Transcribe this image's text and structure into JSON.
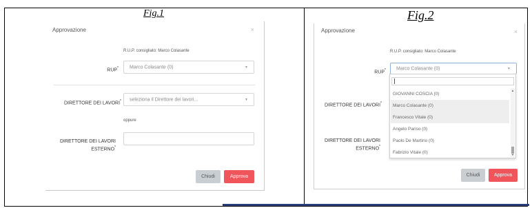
{
  "captions": {
    "fig1": "Fig.1",
    "fig2": "Fig.2"
  },
  "dialog": {
    "title": "Approvazione",
    "close_symbol": "×",
    "rup_hint": "R.U.P. consigliato: Marco Colasante",
    "rup_label": "RUP",
    "rup_value": "Marco Colasante (0)",
    "required_mark": "*",
    "direttore_label": "DIRETTORE DEI LAVORI",
    "direttore_placeholder": "seleziona il Direttore dei lavori...",
    "oppure": "oppure",
    "esterno_label_line1": "DIRETTORE DEI LAVORI",
    "esterno_label_line2": "ESTERNO",
    "esterno_value": "",
    "close_button": "Chiudi",
    "approve_button": "Approva"
  },
  "dropdown": {
    "search_value": "",
    "items": [
      "GIOVANNI COSCIA (0)",
      "Marco Colasante (0)",
      "Francesco Vitale (0)",
      "Angelo Pariso (0)",
      "Paolo De Martino (0)",
      "Fabrizio Vitale (0)"
    ],
    "highlighted": [
      "Marco Colasante (0)",
      "Francesco Vitale (0)"
    ]
  },
  "icons": {
    "caret": "caret-down-icon",
    "close": "close-icon"
  },
  "colors": {
    "approve": "#f0555b",
    "close_btn": "#c9ced3",
    "bottom_rule": "#2a3f7a"
  }
}
